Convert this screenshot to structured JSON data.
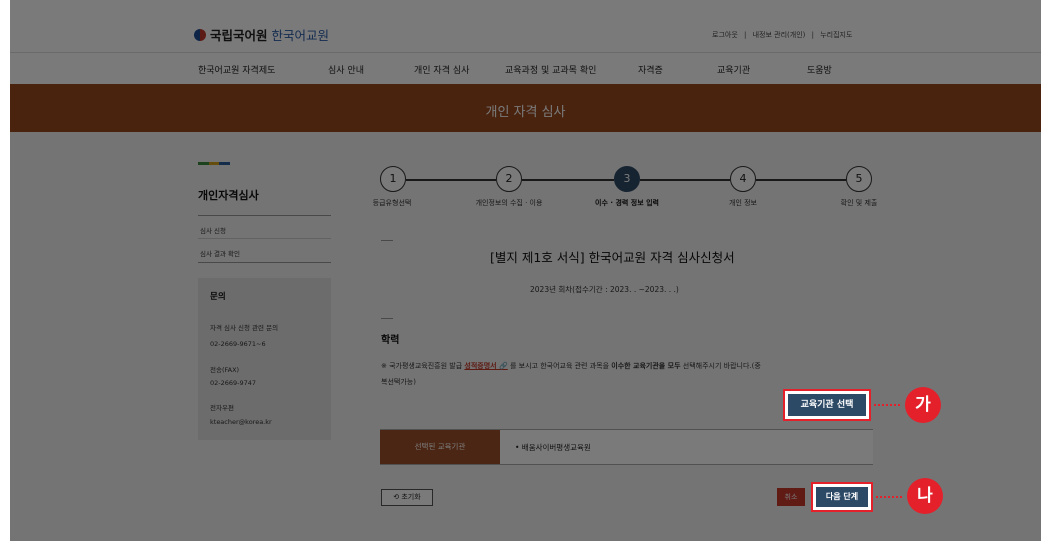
{
  "header": {
    "brand": "국립국어원",
    "sub_brand": "한국어교원",
    "util_links": [
      "로그아웃",
      "내정보 관리(개인)",
      "누리집지도"
    ],
    "util_sep": "|"
  },
  "nav": [
    "한국어교원 자격제도",
    "심사 안내",
    "개인 자격 심사",
    "교육과정 및 교과목 확인",
    "자격증",
    "교육기관",
    "도움방"
  ],
  "banner_title": "개인 자격 심사",
  "sidebar": {
    "title": "개인자격심사",
    "items": [
      "심사 신청",
      "심사 결과 확인"
    ],
    "contact": {
      "heading": "문의",
      "lines": [
        "자격 심사 신청 관련 문의",
        "02-2669-9671~6",
        "전송(FAX)",
        "02-2669-9747",
        "전자우편",
        "kteacher@korea.kr"
      ]
    }
  },
  "steps": [
    {
      "num": "1",
      "label": "등급유형선택"
    },
    {
      "num": "2",
      "label": "개인정보의 수집 · 이용"
    },
    {
      "num": "3",
      "label": "이수 · 경력 정보 입력"
    },
    {
      "num": "4",
      "label": "개인 정보"
    },
    {
      "num": "5",
      "label": "확인 및 제출"
    }
  ],
  "active_step": 3,
  "form": {
    "title": "[별지 제1호 서식] 한국어교원 자격 심사신청서",
    "subtitle": "2023년    회차(접수기간 : 2023.    .    ~2023.    .    .)",
    "section_heading": "학력",
    "notice_prefix": "※ 국가평생교육진흥원 발급",
    "notice_link": "성적증명서 🔗",
    "notice_mid": "를 보시고 한국어교육 관련 과목을",
    "notice_bold": "이수한 교육기관을 모두",
    "notice_end": "선택해주시기 바랍니다.(중",
    "notice_line2": "복선택가능)",
    "select_button": "교육기관 선택",
    "table_label": "선택된 교육기관",
    "table_value": "•  배움사이버평생교육원",
    "reset_button": "⟲ 초기화",
    "cancel_button": "취소",
    "next_button": "다음 단계"
  },
  "callouts": {
    "a": "가",
    "b": "나"
  },
  "colors": {
    "accent": "#9a4a1e",
    "primary": "#2c4966",
    "highlight": "#e4202b"
  }
}
